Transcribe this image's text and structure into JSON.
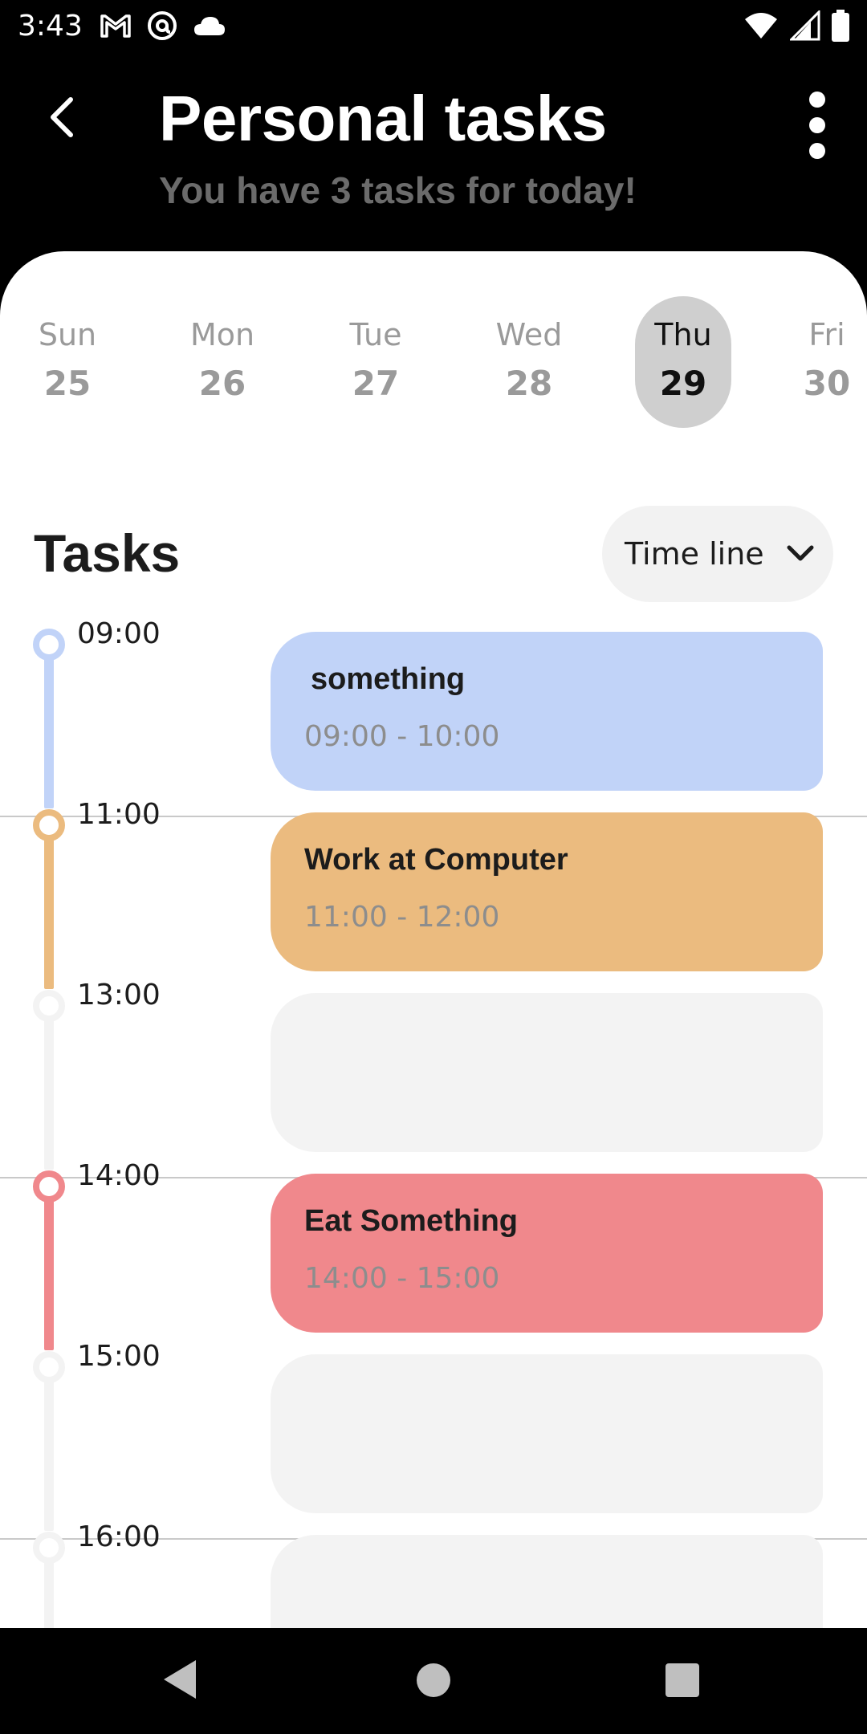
{
  "status_bar": {
    "time": "3:43",
    "left_icons": [
      "gmail-icon",
      "at-sign-icon",
      "cloud-icon"
    ],
    "right_icons": [
      "wifi-icon",
      "cell-signal-icon",
      "battery-icon"
    ]
  },
  "header": {
    "title": "Personal tasks",
    "subtitle": "You have 3 tasks for today!"
  },
  "dates": [
    {
      "name": "Sun",
      "num": "25",
      "selected": false
    },
    {
      "name": "Mon",
      "num": "26",
      "selected": false
    },
    {
      "name": "Tue",
      "num": "27",
      "selected": false
    },
    {
      "name": "Wed",
      "num": "28",
      "selected": false
    },
    {
      "name": "Thu",
      "num": "29",
      "selected": true
    },
    {
      "name": "Fri",
      "num": "30",
      "selected": false
    }
  ],
  "tasks_section": {
    "title": "Tasks",
    "view_mode": "Time line"
  },
  "timeline": [
    {
      "time": "09:00",
      "title": "something",
      "range": "09:00 - 10:00",
      "color": "#c1d3f8",
      "accent": "#c1d3f8"
    },
    {
      "time": "11:00",
      "title": "Work at Computer",
      "range": "11:00 - 12:00",
      "color": "#ebbb7f",
      "accent": "#ebbb7f"
    },
    {
      "time": "13:00",
      "title": "",
      "range": "",
      "color": "#f3f3f3",
      "accent": "#f3f3f3"
    },
    {
      "time": "14:00",
      "title": "Eat Something",
      "range": "14:00 - 15:00",
      "color": "#f0888c",
      "accent": "#f0888c"
    },
    {
      "time": "15:00",
      "title": "",
      "range": "",
      "color": "#f3f3f3",
      "accent": "#f3f3f3"
    },
    {
      "time": "16:00",
      "title": "",
      "range": "",
      "color": "#f3f3f3",
      "accent": "#f3f3f3"
    }
  ],
  "nav_bar": {
    "buttons": [
      "back-nav-icon",
      "home-nav-icon",
      "recents-nav-icon"
    ]
  }
}
